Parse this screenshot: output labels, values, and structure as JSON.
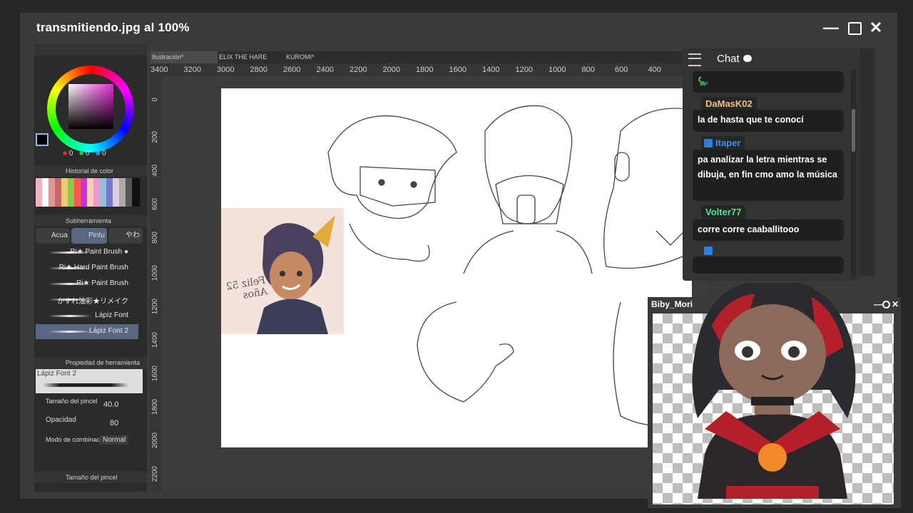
{
  "window": {
    "title": "transmitiendo.jpg al 100%",
    "minimize_icon": "minus-icon",
    "maximize_icon": "square-icon",
    "close_icon": "x-icon"
  },
  "left_panel": {
    "color_values": [
      "0",
      "0",
      "0"
    ],
    "history_title": "Historial de color",
    "subtool_title": "Subherramienta",
    "subtool_tabs": [
      "Acua",
      "Pintu",
      "やわ"
    ],
    "brushes": [
      {
        "label": "Ri★ Paint Brush ●",
        "selected": false
      },
      {
        "label": "Ri★ Hard Paint Brush",
        "selected": false
      },
      {
        "label": "Ri★ Paint Brush",
        "selected": false
      },
      {
        "label": "かすれ油彩★リメイク",
        "selected": false
      },
      {
        "label": "Lápiz Font",
        "selected": false
      },
      {
        "label": "Lápiz Font 2",
        "selected": true
      }
    ],
    "property_title": "Propiedad de herramienta",
    "preview_label": "Lápiz Font 2",
    "brush_size_label": "Tamaño del pincel",
    "brush_size_value": "40.0",
    "opacity_label": "Opacidad",
    "opacity_value": "80",
    "blend_label": "Modo de combinació",
    "blend_value": "Normal",
    "bottom_title": "Tamaño del pincel"
  },
  "canvas": {
    "tabs": [
      "Ilustración*",
      "ELIX THE HARE",
      "KUROMI*"
    ],
    "ruler_labels": [
      "3400",
      "3200",
      "3000",
      "2800",
      "2600",
      "2400",
      "2200",
      "2000",
      "1800",
      "1600",
      "1400",
      "1200",
      "1000",
      "800",
      "600",
      "400"
    ],
    "vruler_labels": [
      "0",
      "200",
      "400",
      "600",
      "800",
      "1000",
      "1200",
      "1400",
      "1600",
      "1800",
      "2000",
      "2200"
    ],
    "signature_text": "Feliz 52\nAños"
  },
  "chat": {
    "title": "Chat",
    "messages": [
      {
        "user": "",
        "user_color": "#ffffff",
        "text": "🦕"
      },
      {
        "user": "DaMasK02",
        "user_color": "#f0c080",
        "text": "la de hasta que te conocí"
      },
      {
        "user": "Itaper",
        "user_color": "#3f8fe8",
        "text": "pa analizar la letra mientras se dibuja, en fin cmo amo la música"
      },
      {
        "user": "Volter77",
        "user_color": "#55e28a",
        "text": "corre corre caaballitooo"
      },
      {
        "user": "",
        "user_color": "#3f8fe8",
        "text": ""
      }
    ]
  },
  "avatar_window": {
    "title": "Biby_Mori"
  }
}
